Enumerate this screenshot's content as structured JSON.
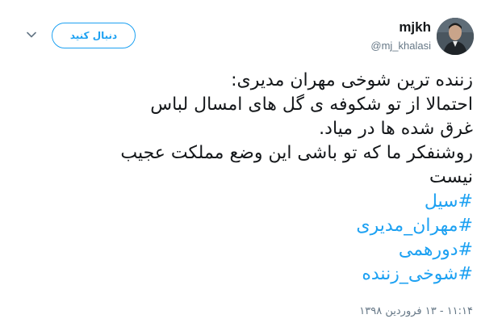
{
  "tweet": {
    "user": {
      "name": "mjkh",
      "handle": "@mj_khalasi"
    },
    "follow_label": "دنبال کنید",
    "text_lines": [
      "زننده ترین شوخی مهران مدیری:",
      "احتمالا از تو شکوفه ی گل های امسال لباس",
      "غرق شده ها در میاد.",
      "روشنفکر ما که تو باشی این وضع مملکت عجیب",
      "نیست"
    ],
    "hashtags": [
      "#سیل",
      "#مهران_مدیری",
      "#دورهمی",
      "#شوخی_زننده"
    ],
    "timestamp": "۱۱:۱۴ - ۱۳ فروردین ۱۳۹۸"
  },
  "colors": {
    "accent": "#1da1f2",
    "text": "#14171a",
    "muted": "#657786"
  },
  "icons": {
    "more": "chevron-down-icon",
    "avatar": "avatar-photo"
  }
}
